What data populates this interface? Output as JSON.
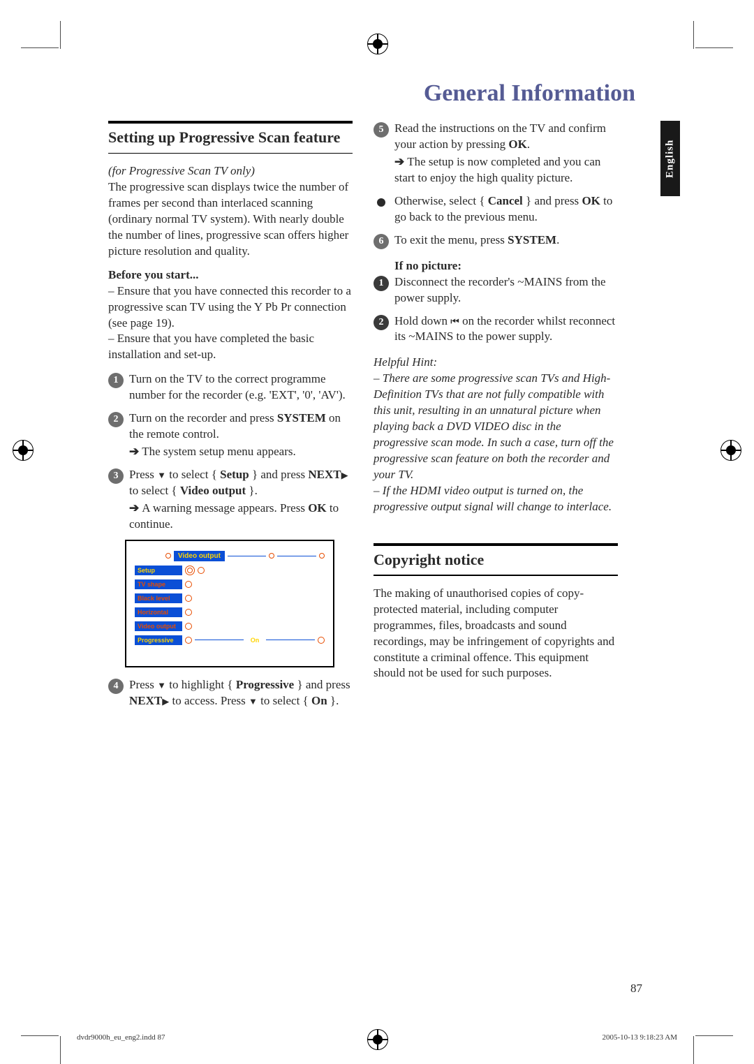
{
  "page_title": "General Information",
  "language_tab": "English",
  "page_number": "87",
  "footer_left": "dvdr9000h_eu_eng2.indd   87",
  "footer_right": "2005-10-13   9:18:23 AM",
  "left": {
    "heading": "Setting up Progressive Scan feature",
    "tv_note": "(for Progressive Scan TV only)",
    "intro": "The progressive scan displays twice the number of frames per second than interlaced scanning (ordinary normal TV system). With nearly double the number of lines, progressive scan offers higher picture resolution and quality.",
    "before_start_heading": "Before you start...",
    "before_1": "– Ensure that you have connected this recorder to a progressive scan TV using the Y Pb Pr connection (see page 19).",
    "before_2": "– Ensure that you have completed the basic installation and set-up.",
    "step1": "Turn on the TV to the correct programme number for the recorder (e.g. 'EXT', '0', 'AV').",
    "step2_a": "Turn on the recorder and press ",
    "step2_b": "SYSTEM",
    "step2_c": " on the remote control.",
    "step2_sub": "The system setup menu appears.",
    "step3_a": "Press ",
    "step3_b": " to select { ",
    "step3_c": "Setup",
    "step3_d": " } and press ",
    "step3_e": "NEXT",
    "step3_f": "  to select { ",
    "step3_g": "Video output",
    "step3_h": " }.",
    "step3_sub": "A warning message appears.  Press OK to continue.",
    "step4_a": "Press ",
    "step4_b": " to highlight { ",
    "step4_c": "Progressive",
    "step4_d": " } and press ",
    "step4_e": "NEXT",
    "step4_f": "  to access.  Press ",
    "step4_g": " to select { ",
    "step4_h": "On",
    "step4_i": " }."
  },
  "menu": {
    "top_label": "Video output",
    "setup": "Setup",
    "tv_shape": "TV shape",
    "black_level": "Black level",
    "horizontal": "Horizontal",
    "video_output": "Video output",
    "progressive": "Progressive",
    "on": "On"
  },
  "right": {
    "step5_a": "Read the instructions on the TV and confirm your action by pressing ",
    "step5_b": "OK",
    "step5_c": ".",
    "step5_sub": "The setup is now completed and you can start to enjoy the high quality picture.",
    "bullet_a": "Otherwise, select { ",
    "bullet_b": "Cancel",
    "bullet_c": " } and press ",
    "bullet_d": "OK",
    "bullet_e": " to go back to the previous menu.",
    "step6_a": "To exit the menu, press ",
    "step6_b": "SYSTEM",
    "step6_c": ".",
    "if_no_pic": "If no picture:",
    "np1": "Disconnect the recorder's ~MAINS from the power supply.",
    "np2_a": "Hold down ",
    "np2_b": " on the recorder whilst reconnect its ~MAINS to the power supply.",
    "hint_heading": "Helpful Hint:",
    "hint1": "– There are some progressive scan TVs and High-Definition TVs that are not fully compatible with this unit, resulting in an unnatural picture when playing back a DVD VIDEO disc in the progressive scan mode. In such a case, turn off the progressive scan feature on both the recorder and your TV.",
    "hint2": "– If the HDMI video output is turned on, the progressive output signal will change to interlace.",
    "copyright_heading": "Copyright notice",
    "copyright_body": "The making of unauthorised copies of copy-protected material, including computer programmes, files, broadcasts and sound recordings, may be infringement of copyrights and constitute a criminal offence.  This equipment should not be used for such purposes."
  }
}
